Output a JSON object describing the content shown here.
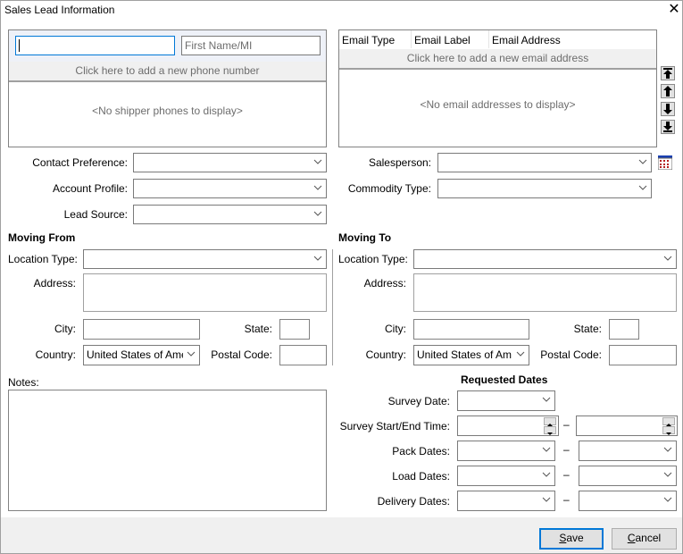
{
  "window": {
    "title": "Sales Lead Information",
    "close_icon": "close-x-icon"
  },
  "name_section": {
    "last_name_value": "",
    "first_name_placeholder": "First Name/MI",
    "add_phone_text": "Click here to add a new phone number",
    "empty_phones_text": "<No shipper phones to display>"
  },
  "email_section": {
    "columns": [
      "Email Type",
      "Email Label",
      "Email Address"
    ],
    "add_email_text": "Click here to add a new email address",
    "empty_emails_text": "<No email addresses to display>",
    "reorder_buttons": [
      "move-top",
      "move-up",
      "move-down",
      "move-bottom"
    ]
  },
  "lead_fields": {
    "contact_preference": {
      "label": "Contact Preference:",
      "value": ""
    },
    "account_profile": {
      "label": "Account Profile:",
      "value": ""
    },
    "lead_source": {
      "label": "Lead Source:",
      "value": ""
    },
    "salesperson": {
      "label": "Salesperson:",
      "value": ""
    },
    "commodity_type": {
      "label": "Commodity Type:",
      "value": ""
    }
  },
  "moving_from": {
    "heading": "Moving From",
    "location_type_label": "Location Type:",
    "location_type_value": "",
    "address_label": "Address:",
    "city_label": "City:",
    "state_label": "State:",
    "country_label": "Country:",
    "country_value": "United States of Ame",
    "postal_code_label": "Postal Code:"
  },
  "moving_to": {
    "heading": "Moving To",
    "location_type_label": "Location Type:",
    "location_type_value": "",
    "address_label": "Address:",
    "city_label": "City:",
    "state_label": "State:",
    "country_label": "Country:",
    "country_value": "United States of Am",
    "postal_code_label": "Postal Code:"
  },
  "notes": {
    "label": "Notes:",
    "value": ""
  },
  "requested_dates": {
    "heading": "Requested Dates",
    "survey_date_label": "Survey Date:",
    "survey_time_label": "Survey Start/End Time:",
    "pack_dates_label": "Pack Dates:",
    "load_dates_label": "Load Dates:",
    "delivery_dates_label": "Delivery Dates:",
    "range_separator": "–"
  },
  "buttons": {
    "save": "Save",
    "cancel": "Cancel"
  }
}
